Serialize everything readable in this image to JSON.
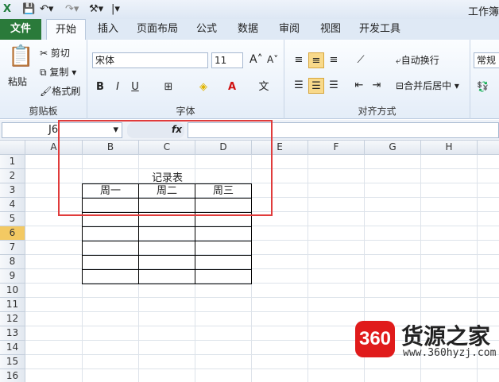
{
  "app": {
    "title": "工作簿"
  },
  "tabs": [
    "文件",
    "开始",
    "插入",
    "页面布局",
    "公式",
    "数据",
    "审阅",
    "视图",
    "开发工具"
  ],
  "clipboard": {
    "paste": "粘贴",
    "cut": "剪切",
    "copy": "复制",
    "format_painter": "格式刷",
    "group": "剪贴板"
  },
  "font": {
    "name": "宋体",
    "size": "11",
    "group": "字体",
    "bold": "B",
    "italic": "I",
    "underline": "U"
  },
  "alignment": {
    "wrap": "自动换行",
    "merge": "合并后居中",
    "group": "对齐方式"
  },
  "number": {
    "format": "常规"
  },
  "formula_bar": {
    "name_box": "J6",
    "fx": "fx"
  },
  "columns": [
    "A",
    "B",
    "C",
    "D",
    "E",
    "F",
    "G",
    "H"
  ],
  "rows": [
    "1",
    "2",
    "3",
    "4",
    "5",
    "6",
    "7",
    "8",
    "9",
    "10",
    "11",
    "12",
    "13",
    "14",
    "15",
    "16"
  ],
  "selected_row": "6",
  "table": {
    "title": "记录表",
    "headers": [
      "周一",
      "周二",
      "周三"
    ]
  },
  "watermark": {
    "number": "360",
    "name": "货源之家",
    "url": "www.360hyzj.com"
  }
}
